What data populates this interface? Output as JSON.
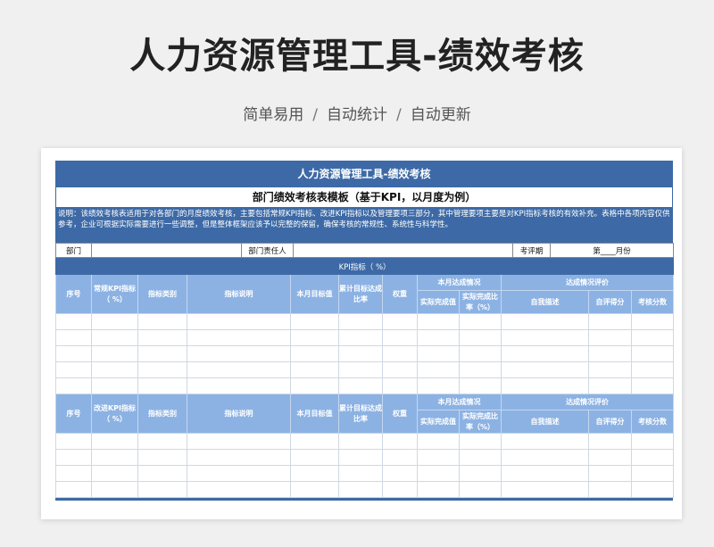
{
  "page": {
    "title": "人力资源管理工具-绩效考核",
    "subtitle_items": [
      "简单易用",
      "自动统计",
      "自动更新"
    ],
    "separator": "/"
  },
  "doc": {
    "banner": "人力资源管理工具-绩效考核",
    "subtitle": "部门绩效考核表模板（基于KPI，以月度为例）",
    "note": "说明：该绩效考核表适用于对各部门的月度绩效考核，主要包括常规KPI指标、改进KPI指标以及管理要项三部分，其中管理要项主要是对KPI指标考核的有效补充。表格中各项内容仅供参考，企业可根据实际需要进行一些调整，但是整体框架应该予以完整的保留，确保考核的常规性、系统性与科学性。",
    "info": {
      "dept_label": "部门",
      "dept_value": "",
      "owner_label": "部门责任人",
      "owner_value": "",
      "period_label": "考评期",
      "period_value": "第____月份"
    },
    "sections": [
      {
        "section_title": "KPI指标（      %）",
        "headers": {
          "seq": "序号",
          "kpi": "常规KPI指标（  %）",
          "type": "指标类别",
          "desc": "指标说明",
          "target": "本月目标值",
          "cumulative": "累计目标达成比率",
          "weight": "权重",
          "month_group": "本月达成情况",
          "actual": "实际完成值",
          "actual_rate": "实际完成比率（%）",
          "eval_group": "达成情况评价",
          "self_desc": "自我描述",
          "self_score": "自评得分",
          "exam_score": "考核分数"
        },
        "row_count": 5
      },
      {
        "section_title": "",
        "headers": {
          "seq": "序号",
          "kpi": "改进KPI指标（  %）",
          "type": "指标类别",
          "desc": "指标说明",
          "target": "本月目标值",
          "cumulative": "累计目标达成比率",
          "weight": "权重",
          "month_group": "本月达成情况",
          "actual": "实际完成值",
          "actual_rate": "实际完成比率（%）",
          "eval_group": "达成情况评价",
          "self_desc": "自我描述",
          "self_score": "自评得分",
          "exam_score": "考核分数"
        },
        "row_count": 4
      }
    ]
  },
  "colors": {
    "banner": "#3d6aa6",
    "header": "#8cb2e3"
  }
}
